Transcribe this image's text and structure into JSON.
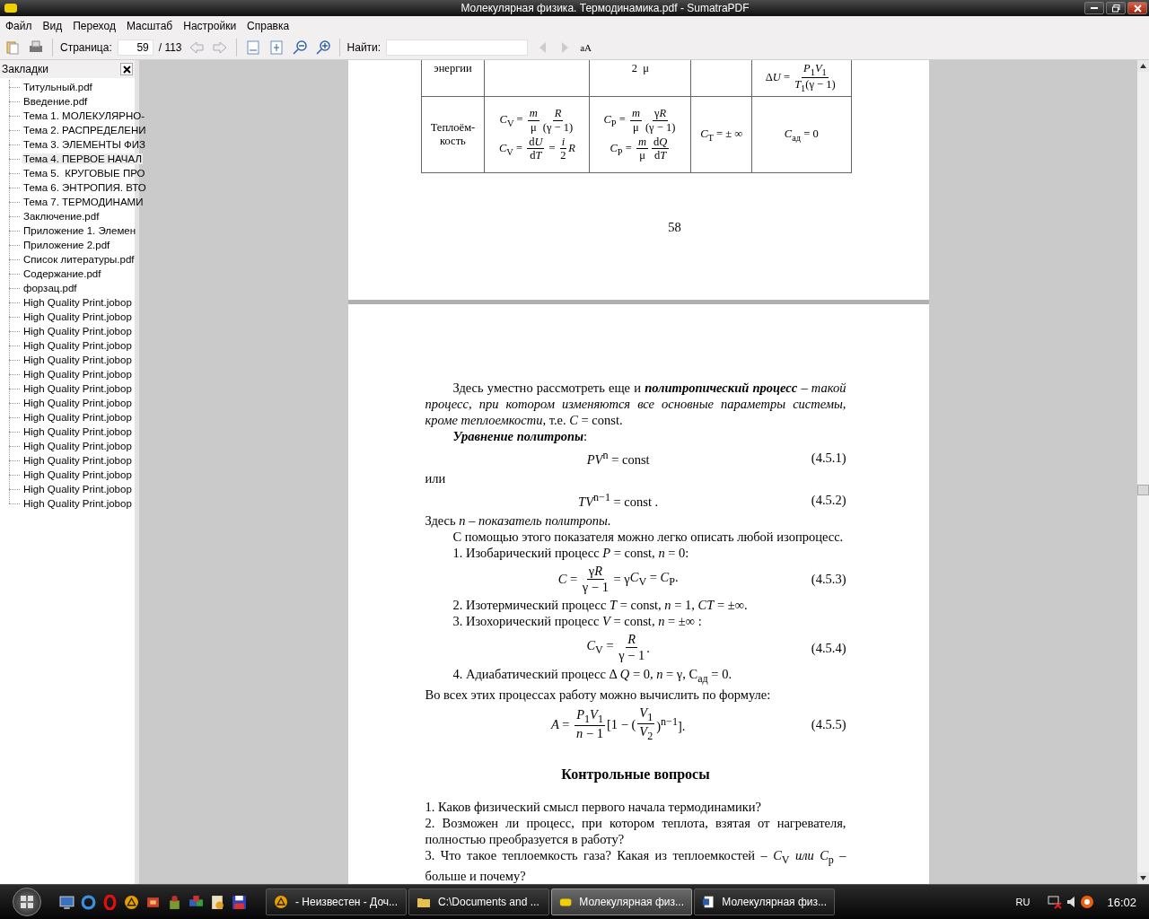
{
  "window": {
    "title": "Молекулярная физика. Термодинамика.pdf - SumatraPDF"
  },
  "menu": [
    "Файл",
    "Вид",
    "Переход",
    "Масштаб",
    "Настройки",
    "Справка"
  ],
  "toolbar": {
    "page_label": "Страница:",
    "page_value": "59",
    "page_total": "/ 113",
    "find_label": "Найти:",
    "match_case": "aA"
  },
  "sidebar": {
    "title": "Закладки",
    "items": [
      {
        "label": "Титульный.pdf",
        "selected": false
      },
      {
        "label": "Введение.pdf",
        "selected": false
      },
      {
        "label": "Тема 1. МОЛЕКУЛЯРНО-",
        "selected": false
      },
      {
        "label": "Тема 2. РАСПРЕДЕЛЕНИ",
        "selected": false
      },
      {
        "label": "Тема 3. ЭЛЕМЕНТЫ ФИЗ",
        "selected": false
      },
      {
        "label": "Тема 4. ПЕРВОЕ НАЧАЛ",
        "selected": true
      },
      {
        "label": "Тема 5.  КРУГОВЫЕ ПРО",
        "selected": false
      },
      {
        "label": "Тема 6. ЭНТРОПИЯ. ВТО",
        "selected": false
      },
      {
        "label": "Тема 7. ТЕРМОДИНАМИ",
        "selected": false
      },
      {
        "label": "Заключение.pdf",
        "selected": false
      },
      {
        "label": "Приложение 1. Элемен",
        "selected": false
      },
      {
        "label": "Приложение 2.pdf",
        "selected": false
      },
      {
        "label": "Список литературы.pdf",
        "selected": false
      },
      {
        "label": "Содержание.pdf",
        "selected": false
      },
      {
        "label": "форзац.pdf",
        "selected": false
      },
      {
        "label": "High Quality Print.jobop",
        "selected": false
      },
      {
        "label": "High Quality Print.jobop",
        "selected": false
      },
      {
        "label": "High Quality Print.jobop",
        "selected": false
      },
      {
        "label": "High Quality Print.jobop",
        "selected": false
      },
      {
        "label": "High Quality Print.jobop",
        "selected": false
      },
      {
        "label": "High Quality Print.jobop",
        "selected": false
      },
      {
        "label": "High Quality Print.jobop",
        "selected": false
      },
      {
        "label": "High Quality Print.jobop",
        "selected": false
      },
      {
        "label": "High Quality Print.jobop",
        "selected": false
      },
      {
        "label": "High Quality Print.jobop",
        "selected": false
      },
      {
        "label": "High Quality Print.jobop",
        "selected": false
      },
      {
        "label": "High Quality Print.jobop",
        "selected": false
      },
      {
        "label": "High Quality Print.jobop",
        "selected": false
      },
      {
        "label": "High Quality Print.jobop",
        "selected": false
      },
      {
        "label": "High Quality Print.jobop",
        "selected": false
      }
    ]
  },
  "pages": [
    {
      "table": {
        "rows": [
          {
            "cells": [
              [
                [
                  "энергии"
                ]
              ],
              [],
              [
                [
                  "2  μ"
                ]
              ],
              [],
              [
                [
                  "Δ",
                  "*U* = ",
                  {
                    "num": "*P*$_{1}$*V*$_{1}$",
                    "den": "*T*$_{1}$(γ − 1)"
                  }
                ]
              ]
            ]
          },
          {
            "cells": [
              [
                [
                  "Теплоём-\nкость"
                ]
              ],
              [
                [
                  "*C*$_{V}$ = ",
                  {
                    "num": "*m*",
                    "den": "μ"
                  },
                  {
                    "num": "*R*",
                    "den": "(γ − 1)"
                  }
                ],
                [
                  "*C*$_{V}$ = ",
                  {
                    "num": [
                      "d",
                      "*U*"
                    ],
                    "den": [
                      "d",
                      "*T*"
                    ]
                  },
                  " = ",
                  {
                    "num": "*i*",
                    "den": "2"
                  },
                  "*R*"
                ]
              ],
              [
                [
                  "*C*$_{P}$ = ",
                  {
                    "num": "*m*",
                    "den": "μ"
                  },
                  {
                    "num": [
                      "γ",
                      "*R*"
                    ],
                    "den": "(γ − 1)"
                  }
                ],
                [
                  "*C*$_{P}$ = ",
                  {
                    "num": "*m*",
                    "den": "μ"
                  },
                  {
                    "num": [
                      "d",
                      "*Q*"
                    ],
                    "den": [
                      "d",
                      "*T*"
                    ]
                  }
                ]
              ],
              [
                [
                  "*C*$_{T}$ = ± ∞"
                ]
              ],
              [
                [
                  "*C*$_{ад}$ = 0"
                ]
              ]
            ]
          }
        ]
      },
      "page_number": "58"
    },
    {
      "blocks": [
        {
          "kind": "indent",
          "text": "Здесь уместно рассмотреть еще и **политропический процесс** – *такой процесс, при котором изменяются все основные параметры системы, кроме теплоемкости*, т.е. *C* = const."
        },
        {
          "kind": "indent",
          "text": "**Уравнение политропы**:"
        },
        {
          "kind": "equation",
          "parts": [
            "*PV*$^{n}$ = const"
          ],
          "number": "(4.5.1)"
        },
        {
          "kind": "plain",
          "text": "или"
        },
        {
          "kind": "equation",
          "parts": [
            "*TV*$^{n−1}$ = const ."
          ],
          "number": "(4.5.2)"
        },
        {
          "kind": "plain",
          "text": "Здесь *n – показатель политропы.*"
        },
        {
          "kind": "indent",
          "text": "С помощью этого показателя можно легко описать любой изопроцесс."
        },
        {
          "kind": "indent",
          "text": "1. Изобарический процесс  *P* = const,  *n* = 0:"
        },
        {
          "kind": "equation",
          "parts": [
            "*C* = ",
            {
              "num": [
                "γ",
                "*R*"
              ],
              "den": "γ − 1"
            },
            " = γ",
            "*C*$_{V}$ = *C*$_{P}$."
          ],
          "number": "(4.5.3)"
        },
        {
          "kind": "indent",
          "text": "2. Изотермический процесс  *T* = const,  *n* = 1,  *CT* = ±∞."
        },
        {
          "kind": "indent",
          "text": "3. Изохорический процесс  *V* = const,  *n* = ±∞ :"
        },
        {
          "kind": "equation",
          "parts": [
            "*C*$_{V}$ = ",
            {
              "num": "*R*",
              "den": "γ − 1"
            },
            "."
          ],
          "number": "(4.5.4)"
        },
        {
          "kind": "indent",
          "text": "4. Адиабатический процесс Δ *Q* = 0, *n* = γ, C$_{ад}$ = 0."
        },
        {
          "kind": "plain",
          "text": "Во всех этих процессах работу можно вычислить по формуле:"
        },
        {
          "kind": "equation",
          "parts": [
            "*A* = ",
            {
              "num": "*P*$_{1}$*V*$_{1}$",
              "den": "*n* − 1"
            },
            "[1 − (",
            {
              "num": "*V*$_{1}$",
              "den": "*V*$_{2}$"
            },
            ")$^{n−1}$]."
          ],
          "number": "(4.5.5)"
        },
        {
          "kind": "heading",
          "text": "Контрольные вопросы"
        },
        {
          "kind": "plain",
          "text": "1. Каков физический смысл первого начала термодинамики?"
        },
        {
          "kind": "plain",
          "text": "2. Возможен ли процесс, при котором теплота, взятая от нагревателя, полностью преобразуется в работу?"
        },
        {
          "kind": "plain",
          "text": "3. Что такое теплоемкость газа? Какая из теплоемкостей – *C*$_{V}$ *или C*$_{p}$ – больше и почему?"
        }
      ]
    }
  ],
  "taskbar": {
    "tasks": [
      {
        "label": "- Неизвестен - Доч...",
        "kind": "player",
        "selected": false
      },
      {
        "label": "C:\\Documents and ...",
        "kind": "folder",
        "selected": false
      },
      {
        "label": "Молекулярная физ...",
        "kind": "pdf",
        "selected": true
      },
      {
        "label": "Молекулярная физ...",
        "kind": "word",
        "selected": false
      }
    ],
    "language": "RU",
    "clock": "16:02"
  }
}
